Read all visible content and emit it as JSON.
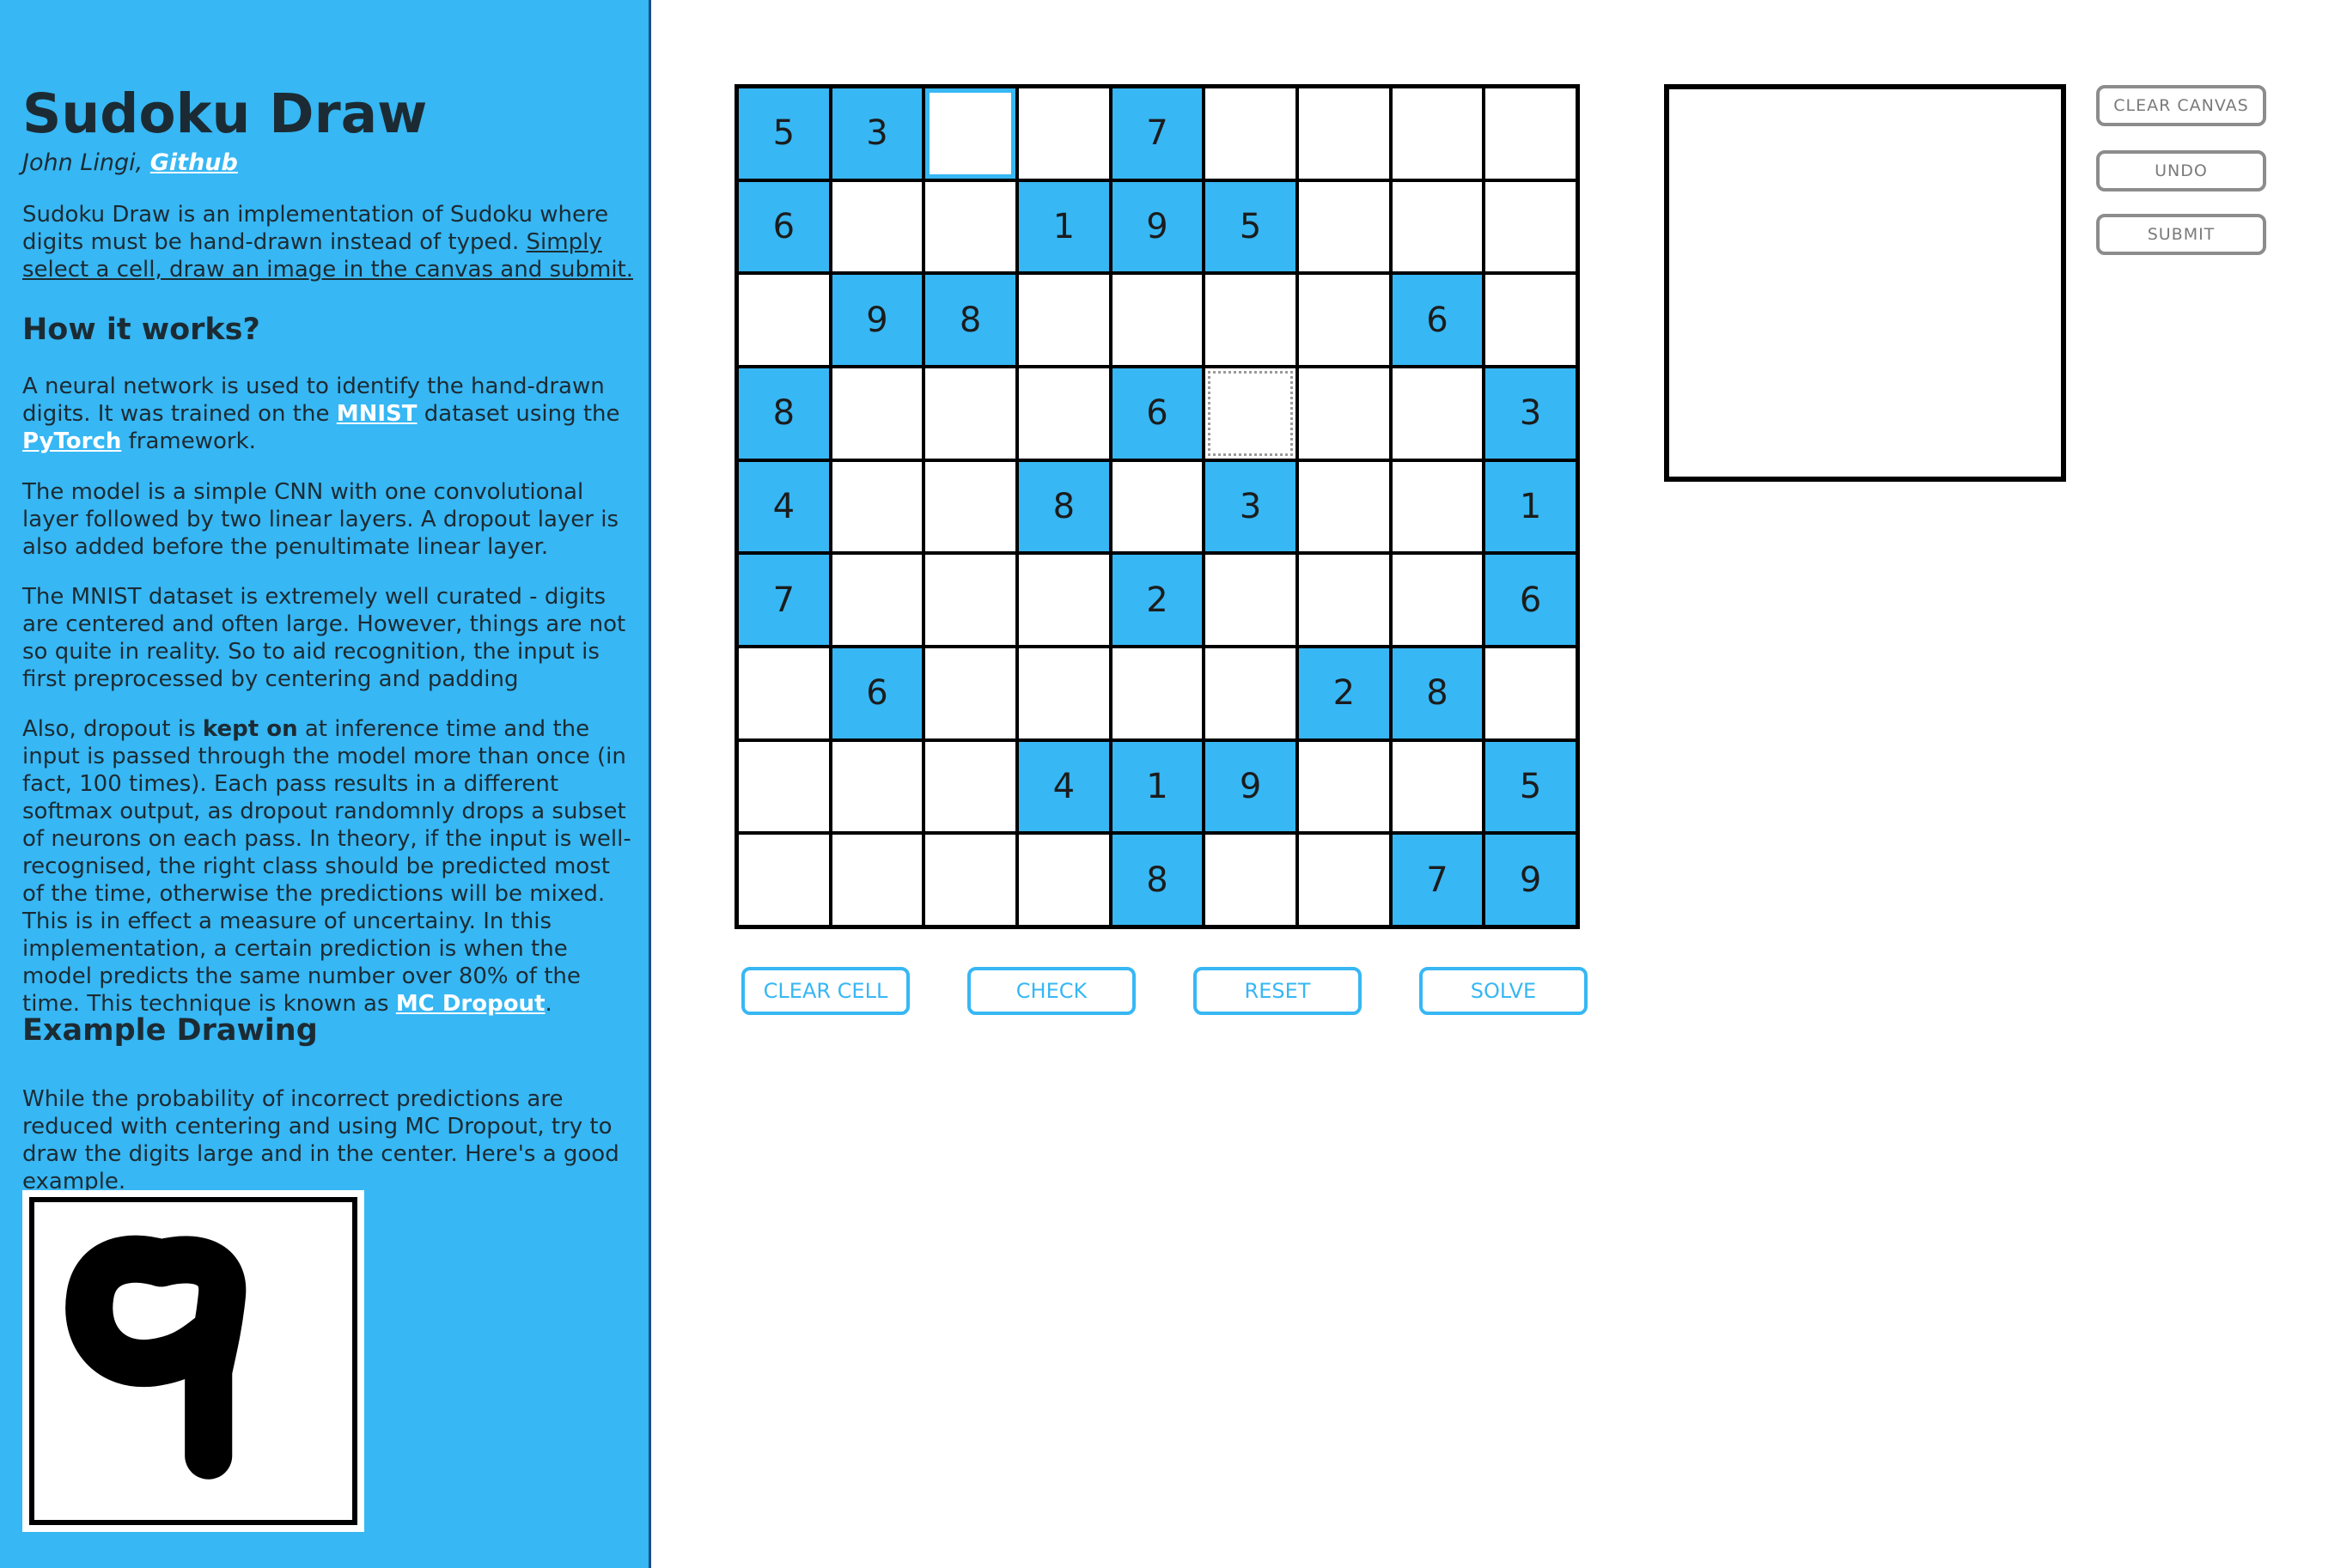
{
  "sidebar": {
    "title": "Sudoku Draw",
    "author": "John Lingi,",
    "github_link": "Github",
    "intro_1": "Sudoku Draw is an implementation of Sudoku where digits must be hand-drawn instead of typed. ",
    "intro_2": "Simply select a cell, draw an image in the canvas and submit.",
    "how_heading": "How it works?",
    "how_p1_a": "A neural network is used to identify the hand-drawn digits. It was trained on the ",
    "mnist_link": "MNIST",
    "how_p1_b": " dataset using the ",
    "pytorch_link": "PyTorch",
    "how_p1_c": " framework.",
    "how_p2": "The model is a simple CNN with one convolutional layer followed by two linear layers. A dropout layer is also added before the penultimate linear layer.",
    "how_p3": "The MNIST dataset is extremely well curated - digits are centered and often large. However, things are not so quite in reality. So to aid recognition, the input is first preprocessed by centering and padding",
    "how_p4_a": "Also, dropout is ",
    "how_p4_bold": "kept on",
    "how_p4_b": " at inference time and the input is passed through the model more than once (in fact, 100 times). Each pass results in a different softmax output, as dropout randomnly drops a subset of neurons on each pass. In theory, if the input is well-recognised, the right class should be predicted most of the time, otherwise the predictions will be mixed. This is in effect a measure of uncertainy. In this implementation, a certain prediction is when the model predicts the same number over 80% of the time. This technique is known as ",
    "mc_link": "MC Dropout",
    "how_p4_c": ".",
    "example_heading": "Example Drawing",
    "example_p": "While the probability of incorrect predictions are reduced with centering and using MC Dropout, try to draw the digits large and in the center. Here's a good example."
  },
  "grid": [
    [
      "5",
      "3",
      "",
      "",
      "7",
      "",
      "",
      "",
      ""
    ],
    [
      "6",
      "",
      "",
      "1",
      "9",
      "5",
      "",
      "",
      ""
    ],
    [
      "",
      "9",
      "8",
      "",
      "",
      "",
      "",
      "6",
      ""
    ],
    [
      "8",
      "",
      "",
      "",
      "6",
      "",
      "",
      "",
      "3"
    ],
    [
      "4",
      "",
      "",
      "8",
      "",
      "3",
      "",
      "",
      "1"
    ],
    [
      "7",
      "",
      "",
      "",
      "2",
      "",
      "",
      "",
      "6"
    ],
    [
      "",
      "6",
      "",
      "",
      "",
      "",
      "2",
      "8",
      ""
    ],
    [
      "",
      "",
      "",
      "4",
      "1",
      "9",
      "",
      "",
      "5"
    ],
    [
      "",
      "",
      "",
      "",
      "8",
      "",
      "",
      "7",
      "9"
    ]
  ],
  "selected_cell": [
    0,
    2
  ],
  "focused_cell": [
    3,
    5
  ],
  "grid_buttons": {
    "clear_cell": "CLEAR CELL",
    "check": "CHECK",
    "reset": "RESET",
    "solve": "SOLVE"
  },
  "canvas_buttons": {
    "clear_canvas": "CLEAR CANVAS",
    "undo": "UNDO",
    "submit": "SUBMIT"
  },
  "colors": {
    "accent": "#37b7f4",
    "text": "#1c2b33"
  }
}
